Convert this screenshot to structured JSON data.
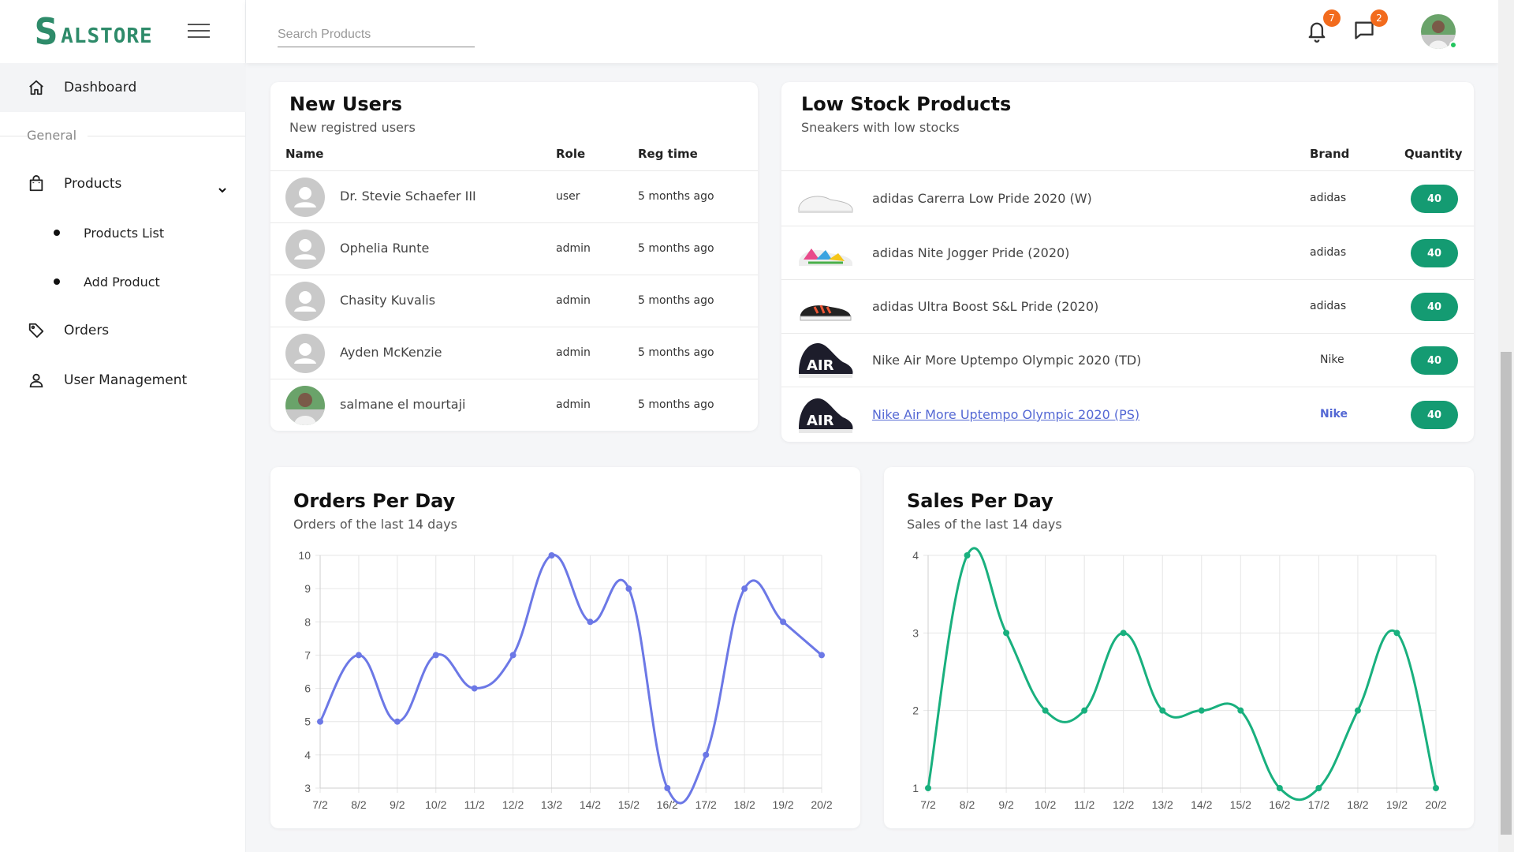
{
  "app": {
    "logo_initial": "S",
    "logo_rest": "ALSTORE",
    "brand_color": "#2e8b6a"
  },
  "sidebar": {
    "items": [
      {
        "label": "Dashboard",
        "icon": "home-icon"
      },
      {
        "label": "Products",
        "icon": "shopping-bag-icon"
      },
      {
        "label": "Orders",
        "icon": "tag-icon"
      },
      {
        "label": "User Management",
        "icon": "user-icon"
      }
    ],
    "section_label": "General",
    "product_subitems": [
      "Products List",
      "Add Product"
    ]
  },
  "topbar": {
    "search_placeholder": "Search Products",
    "notifications_count": "7",
    "messages_count": "2",
    "badge_color": "#f26b1d"
  },
  "new_users": {
    "title": "New Users",
    "subtitle": "New registred users",
    "headers": {
      "name": "Name",
      "role": "Role",
      "reg_time": "Reg time"
    },
    "rows": [
      {
        "name": "Dr. Stevie Schaefer III",
        "role": "user",
        "reg_time": "5 months ago"
      },
      {
        "name": "Ophelia Runte",
        "role": "admin",
        "reg_time": "5 months ago"
      },
      {
        "name": "Chasity Kuvalis",
        "role": "admin",
        "reg_time": "5 months ago"
      },
      {
        "name": "Ayden McKenzie",
        "role": "admin",
        "reg_time": "5 months ago"
      },
      {
        "name": "salmane el mourtaji",
        "role": "admin",
        "reg_time": "5 months ago"
      }
    ]
  },
  "low_stock": {
    "title": "Low Stock Products",
    "subtitle": "Sneakers with low stocks",
    "headers": {
      "brand": "Brand",
      "quantity": "Quantity"
    },
    "rows": [
      {
        "name": "adidas Carerra Low Pride 2020 (W)",
        "brand": "adidas",
        "quantity": "40"
      },
      {
        "name": "adidas Nite Jogger Pride (2020)",
        "brand": "adidas",
        "quantity": "40"
      },
      {
        "name": "adidas Ultra Boost S&L Pride (2020)",
        "brand": "adidas",
        "quantity": "40"
      },
      {
        "name": "Nike Air More Uptempo Olympic 2020 (TD)",
        "brand": "Nike",
        "quantity": "40"
      },
      {
        "name": "Nike Air More Uptempo Olympic 2020 (PS)",
        "brand": "Nike",
        "quantity": "40"
      }
    ],
    "quantity_color": "#149b72"
  },
  "orders_chart": {
    "title": "Orders Per Day",
    "subtitle": "Orders of the last 14 days"
  },
  "sales_chart": {
    "title": "Sales Per Day",
    "subtitle": "Sales of the last 14 days"
  },
  "chart_data": [
    {
      "type": "line",
      "title": "Orders Per Day",
      "categories": [
        "7/2",
        "8/2",
        "9/2",
        "10/2",
        "11/2",
        "12/2",
        "13/2",
        "14/2",
        "15/2",
        "16/2",
        "17/2",
        "18/2",
        "19/2",
        "20/2"
      ],
      "values": [
        5,
        7,
        5,
        7,
        6,
        7,
        10,
        8,
        9,
        3,
        4,
        9,
        8,
        7
      ],
      "ylim": [
        3,
        10
      ],
      "yticks": [
        3,
        4,
        5,
        6,
        7,
        8,
        9,
        10
      ],
      "color": "#6c78e6",
      "grid": true
    },
    {
      "type": "line",
      "title": "Sales Per Day",
      "categories": [
        "7/2",
        "8/2",
        "9/2",
        "10/2",
        "11/2",
        "12/2",
        "13/2",
        "14/2",
        "15/2",
        "16/2",
        "17/2",
        "18/2",
        "19/2",
        "20/2"
      ],
      "values": [
        1,
        4,
        3,
        2,
        2,
        3,
        2,
        2,
        2,
        1,
        1,
        2,
        3,
        1
      ],
      "ylim": [
        1,
        4
      ],
      "yticks": [
        1,
        2,
        3,
        4
      ],
      "color": "#19b07e",
      "grid": true
    }
  ]
}
